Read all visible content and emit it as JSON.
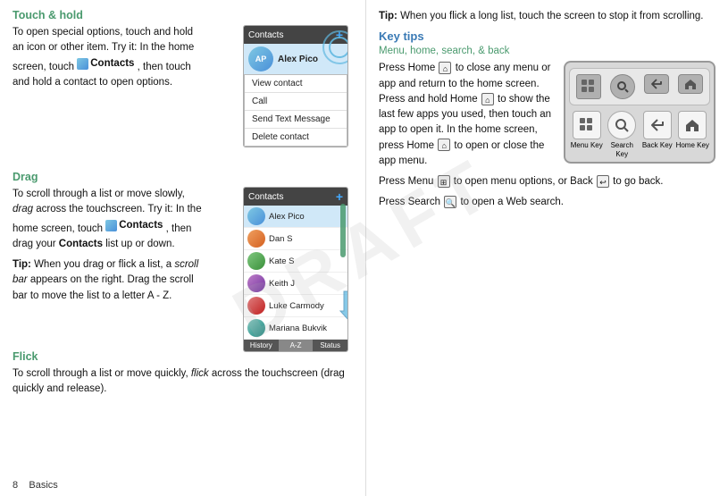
{
  "page": {
    "watermark": "DRAFT",
    "footer_number": "8",
    "footer_label": "Basics"
  },
  "left_col": {
    "section1": {
      "heading": "Touch & hold",
      "para1": "To open special options, touch and hold an icon or other item. Try it: In the home screen, touch",
      "contacts_label": "Contacts",
      "para1b": ", then touch and hold a contact to open options.",
      "contacts_header": "Contacts",
      "plus_btn": "+",
      "contact_name": "Alex Pico",
      "menu_items": [
        "View contact",
        "Call",
        "Send Text Message",
        "Delete contact"
      ]
    },
    "section2": {
      "heading": "Drag",
      "para1": "To scroll through a list or move slowly,",
      "italic_word": "drag",
      "para1b": "across the touchscreen. Try it: In the home screen, touch",
      "contacts_label": "Contacts",
      "para1c": ", then drag your",
      "bold_word": "Contacts",
      "para1d": "list up or down.",
      "tip_label": "Tip:",
      "tip_text": "When you drag or flick a list, a",
      "italic_scroll": "scroll bar",
      "tip_text2": "appears on the right. Drag the scroll bar to move the list to a letter A - Z.",
      "contacts_header": "Contacts",
      "plus_btn": "+",
      "contacts": [
        {
          "name": "Alex Pico",
          "color": "av-blue"
        },
        {
          "name": "Dan S",
          "color": "av-orange"
        },
        {
          "name": "Kate S",
          "color": "av-green"
        },
        {
          "name": "Keith J",
          "color": "av-purple"
        },
        {
          "name": "Luke Carmody",
          "color": "av-red"
        },
        {
          "name": "Mariana Bukvik",
          "color": "av-teal"
        }
      ],
      "tabs": [
        "History",
        "A-Z",
        "Status"
      ]
    },
    "section3": {
      "heading": "Flick",
      "para": "To scroll through a list or move quickly,",
      "italic_word": "flick",
      "para2": "across the touchscreen (drag quickly and release)."
    }
  },
  "right_col": {
    "tip_label": "Tip:",
    "tip_text": "When you flick a long list, touch the screen to stop it from scrolling.",
    "section_heading": "Key tips",
    "sub_heading": "Menu, home, search, & back",
    "para1_start": "Press Home",
    "para1_mid": "to close any menu or app and return to the home screen. Press and hold Home",
    "para1_mid2": "to show the last few apps you used, then touch an app to open it. In the home screen, press Home",
    "para1_end": "to open or close the app menu.",
    "para2_start": "Press Menu",
    "para2_mid": "to open menu options, or Back",
    "para2_end": "to go back.",
    "para3_start": "Press Search",
    "para3_end": "to open a Web search.",
    "keys": [
      {
        "label": "Menu\nKey",
        "icon": "⊞"
      },
      {
        "label": "Search\nKey",
        "icon": "🔍"
      },
      {
        "label": "Back\nKey",
        "icon": "↩"
      },
      {
        "label": "Home\nKey",
        "icon": "⌂"
      }
    ]
  }
}
